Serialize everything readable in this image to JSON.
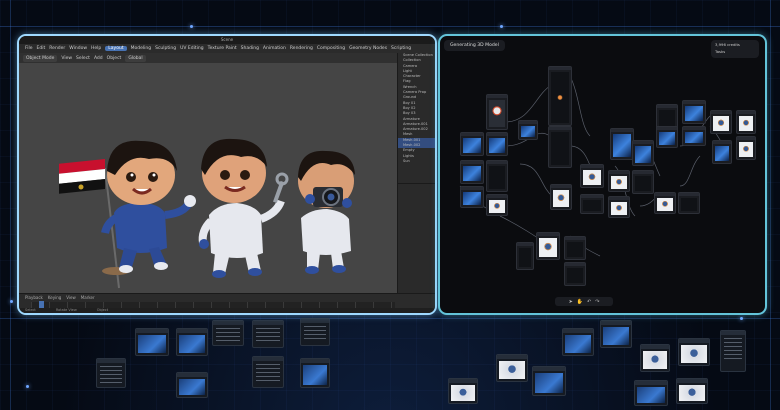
{
  "blender": {
    "title": "Scene",
    "menu": [
      "File",
      "Edit",
      "Render",
      "Window",
      "Help",
      "Layout",
      "Modeling",
      "Sculpting",
      "UV Editing",
      "Texture Paint",
      "Shading",
      "Animation",
      "Rendering",
      "Compositing",
      "Geometry Nodes",
      "Scripting"
    ],
    "active_workspace": "Layout",
    "toolbar": [
      "Object Mode",
      "View",
      "Select",
      "Add",
      "Object",
      "Global"
    ],
    "outliner_rows": [
      "Scene Collection",
      "Collection",
      "Camera",
      "Light",
      "Character",
      "Flag",
      "Wrench",
      "Camera Prop",
      "Ground",
      "Boy 01",
      "Boy 02",
      "Boy 03",
      "Armature",
      "Armature.001",
      "Armature.002",
      "Mesh",
      "Mesh.001",
      "Mesh.002",
      "Empty",
      "Lights",
      "Sun"
    ],
    "timeline_controls": [
      "Playback",
      "Keying",
      "View",
      "Marker"
    ],
    "status": [
      "Select",
      "Rotate View",
      "Object"
    ]
  },
  "nodes": {
    "title": "Generating 3D Model",
    "credits": "3,996 credits",
    "credits_sub": "Tasks"
  },
  "colors": {
    "blender_border": "#9fd9ff",
    "node_border": "#63c4d9",
    "accent": "#4772b3",
    "flag_red": "#c8102e",
    "flag_black": "#111111",
    "flag_white": "#ffffff"
  },
  "icons": [
    "flag-icon",
    "camera-icon",
    "wrench-icon",
    "rocket-icon",
    "pointer-icon",
    "hand-icon",
    "undo-icon",
    "redo-icon"
  ]
}
